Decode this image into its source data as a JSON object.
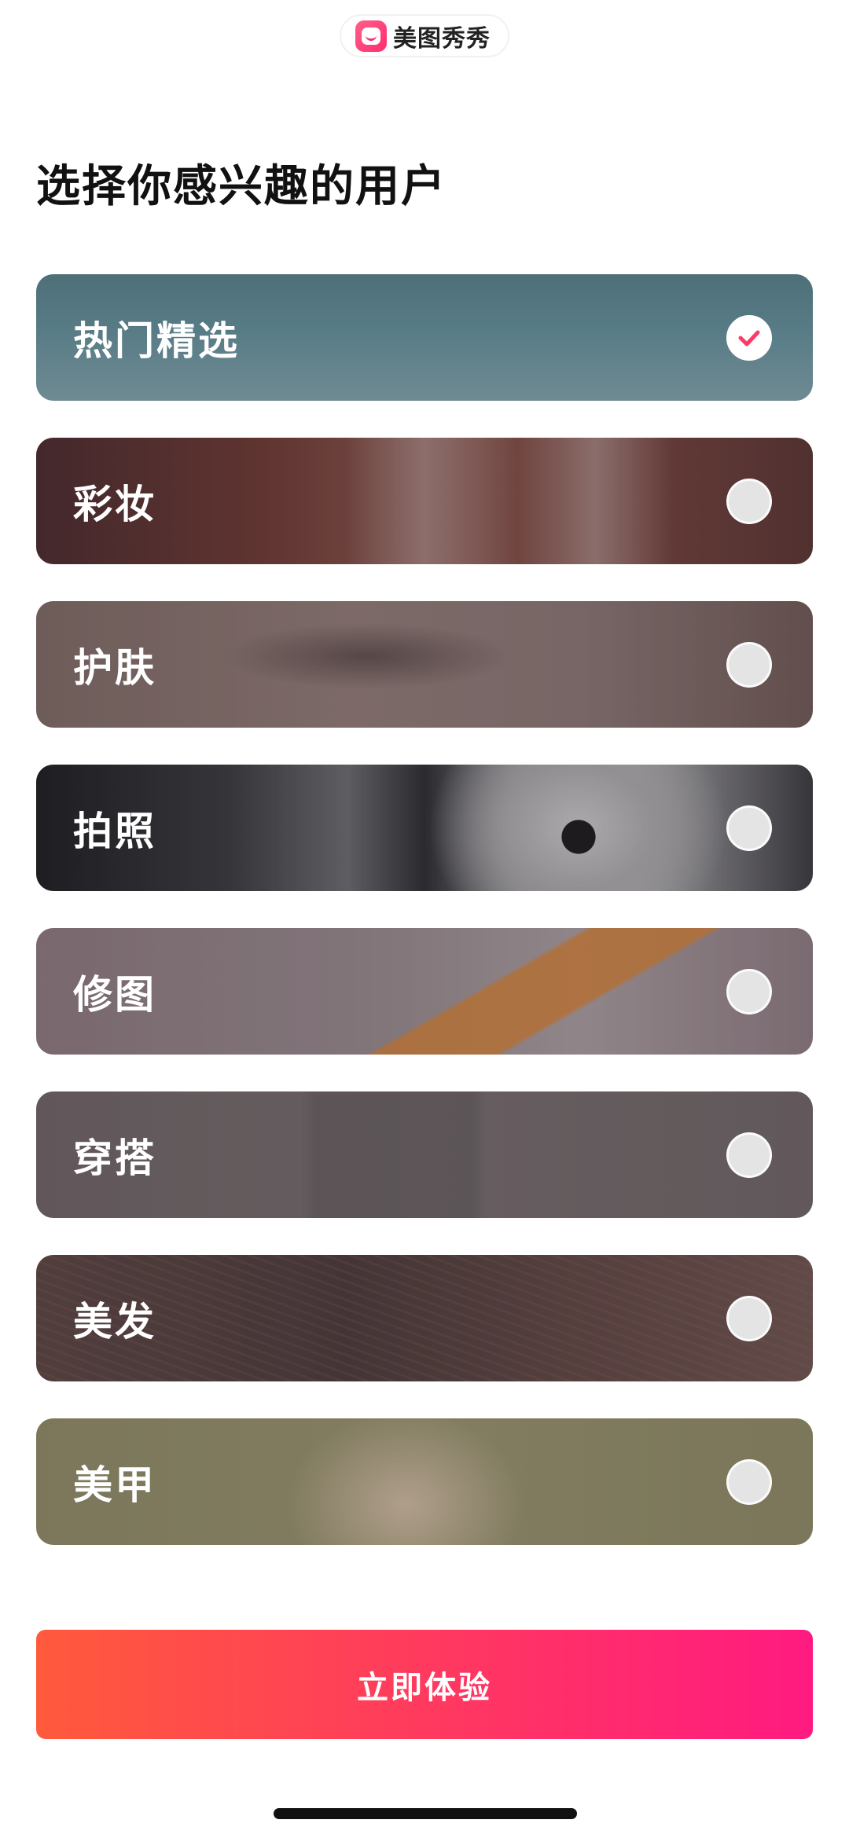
{
  "app": {
    "brand_name": "美图秀秀",
    "brand_icon": "meitu-logo-icon",
    "accent_color": "#ff2d6f"
  },
  "page": {
    "title": "选择你感兴趣的用户"
  },
  "categories": [
    {
      "label": "热门精选",
      "selected": true
    },
    {
      "label": "彩妆",
      "selected": false
    },
    {
      "label": "护肤",
      "selected": false
    },
    {
      "label": "拍照",
      "selected": false
    },
    {
      "label": "修图",
      "selected": false
    },
    {
      "label": "穿搭",
      "selected": false
    },
    {
      "label": "美发",
      "selected": false
    },
    {
      "label": "美甲",
      "selected": false
    }
  ],
  "cta": {
    "label": "立即体验",
    "gradient_start": "#ff5a3c",
    "gradient_end": "#ff1a80"
  }
}
